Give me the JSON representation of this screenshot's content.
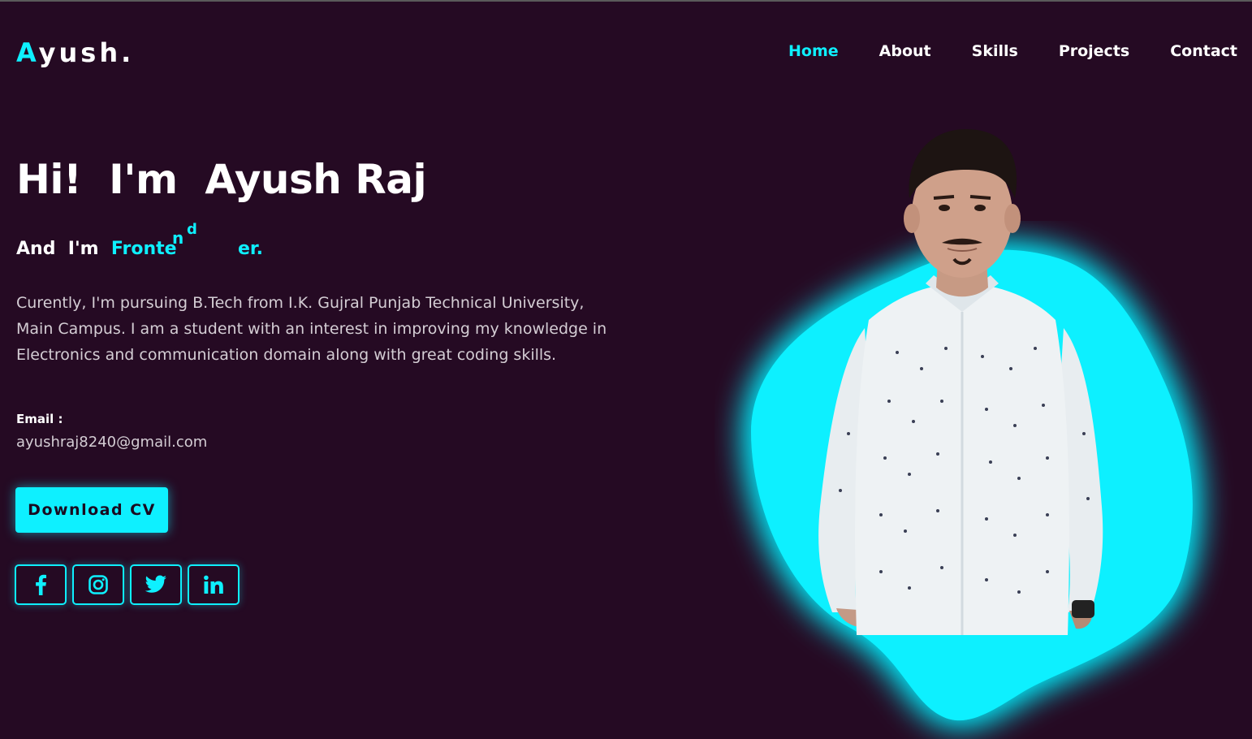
{
  "header": {
    "logo_first": "A",
    "logo_rest": "yush.",
    "nav": [
      {
        "label": "Home",
        "active": true
      },
      {
        "label": "About",
        "active": false
      },
      {
        "label": "Skills",
        "active": false
      },
      {
        "label": "Projects",
        "active": false
      },
      {
        "label": "Contact",
        "active": false
      }
    ]
  },
  "hero": {
    "title": "Hi!  I'm  Ayush Raj",
    "role_prefix": "And  I'm  ",
    "role_typed": "Fronte",
    "role_letter_n": "n",
    "role_letter_d": "d",
    "role_tail": "er.",
    "description": "Curently, I'm pursuing B.Tech from I.K. Gujral Punjab Technical University, Main Campus. I am a student with an interest in improving my knowledge in Electronics and communication domain along with great coding skills.",
    "email_label": "Email :",
    "email_value": "ayushraj8240@gmail.com",
    "cv_button": "Download CV"
  },
  "socials": [
    {
      "icon": "facebook-icon"
    },
    {
      "icon": "instagram-icon"
    },
    {
      "icon": "twitter-icon"
    },
    {
      "icon": "linkedin-icon"
    }
  ],
  "colors": {
    "background": "#250a23",
    "accent": "#0ef0ff",
    "text": "#ffffff",
    "muted_text": "#d4cdd4"
  }
}
